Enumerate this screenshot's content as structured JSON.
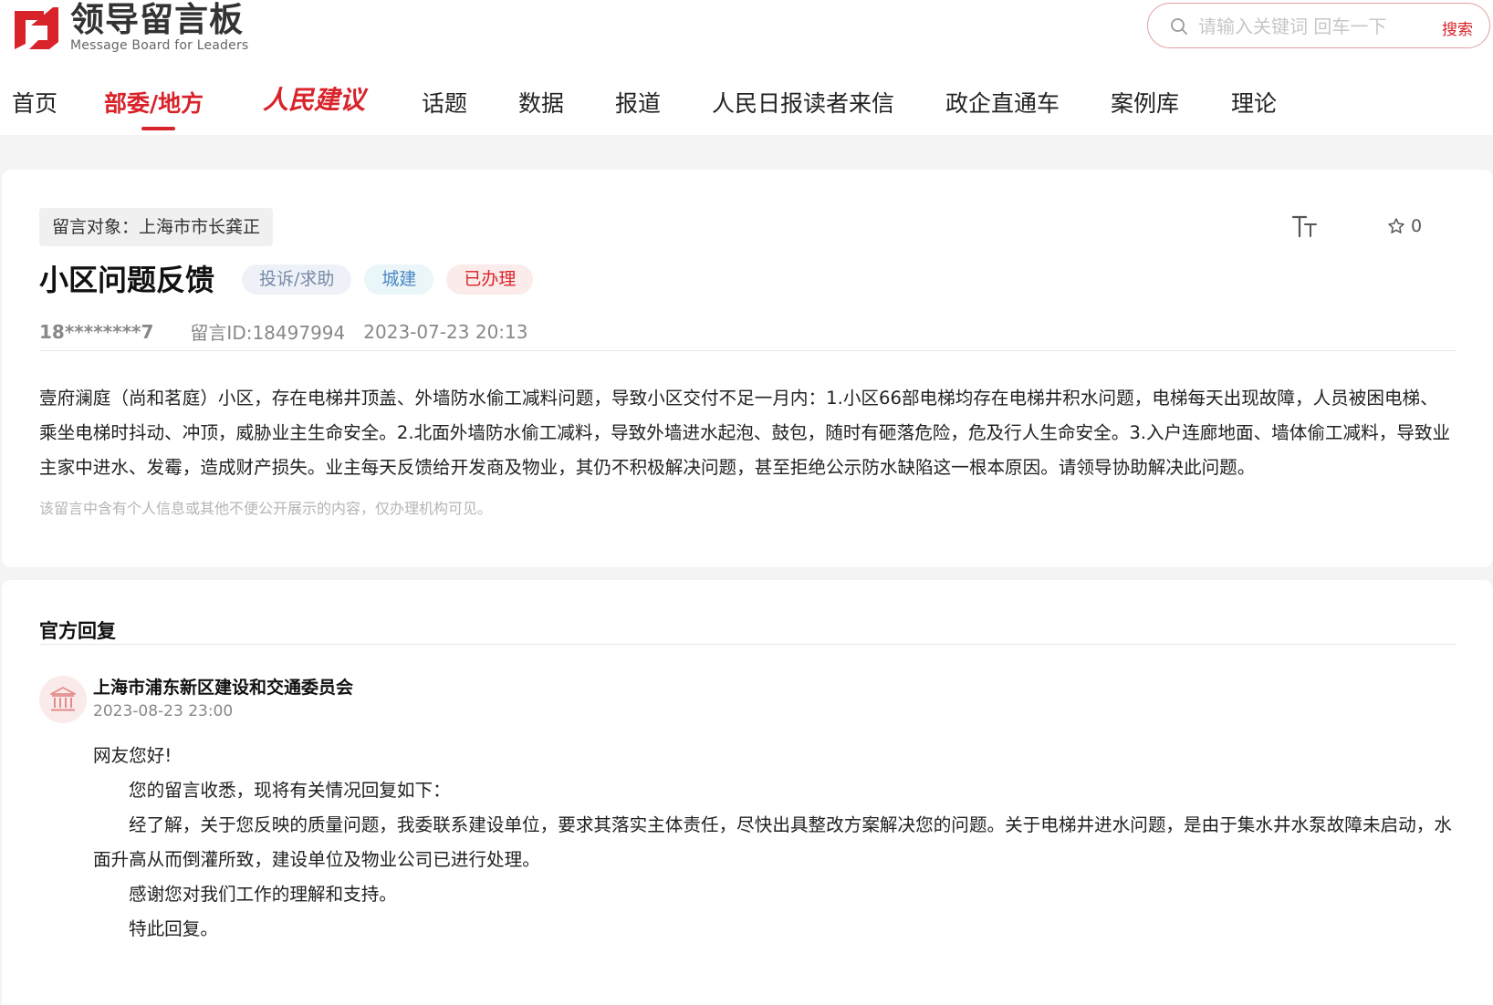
{
  "header": {
    "logo_cn": "领导留言板",
    "logo_en": "Message Board for Leaders",
    "search_placeholder": "请输入关键词 回车一下",
    "search_button": "搜索",
    "accent_color": "#d8232a"
  },
  "nav": {
    "items": [
      "首页",
      "部委/地方",
      "人民建议",
      "话题",
      "数据",
      "报道",
      "人民日报读者来信",
      "政企直通车",
      "案例库",
      "理论"
    ],
    "active": "部委/地方"
  },
  "message": {
    "target_label": "留言对象：上海市市长龚正",
    "favorite_count": "0",
    "title": "小区问题反馈",
    "tags": [
      "投诉/求助",
      "城建",
      "已办理"
    ],
    "user": "18********7",
    "message_id": "留言ID:18497994",
    "datetime": "2023-07-23 20:13",
    "content": "壹府澜庭（尚和茗庭）小区，存在电梯井顶盖、外墙防水偷工减料问题，导致小区交付不足一月内：1.小区66部电梯均存在电梯井积水问题，电梯每天出现故障，人员被困电梯、乘坐电梯时抖动、冲顶，威胁业主生命安全。2.北面外墙防水偷工减料，导致外墙进水起泡、鼓包，随时有砸落危险，危及行人生命安全。3.入户连廊地面、墙体偷工减料，导致业主家中进水、发霉，造成财产损失。业主每天反馈给开发商及物业，其仍不积极解决问题，甚至拒绝公示防水缺陷这一根本原因。请领导协助解决此问题。",
    "privacy_note": "该留言中含有个人信息或其他不便公开展示的内容，仅办理机构可见。"
  },
  "reply": {
    "heading": "官方回复",
    "org_name": "上海市浦东新区建设和交通委员会",
    "datetime": "2023-08-23 23:00",
    "greeting": "网友您好!",
    "p1": "您的留言收悉，现将有关情况回复如下：",
    "p2": "经了解，关于您反映的质量问题，我委联系建设单位，要求其落实主体责任，尽快出具整改方案解决您的问题。关于电梯井进水问题，是由于集水井水泵故障未启动，水面升高从而倒灌所致，建设单位及物业公司已进行处理。",
    "p3": "感谢您对我们工作的理解和支持。",
    "p4": "特此回复。"
  }
}
